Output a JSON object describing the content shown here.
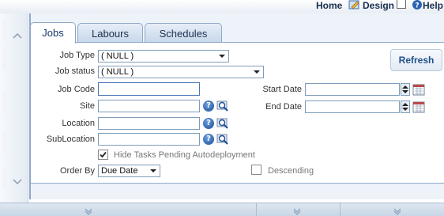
{
  "topnav": {
    "home": "Home",
    "design": "Design",
    "help": "Help"
  },
  "tabs": [
    {
      "label": "Jobs",
      "active": true
    },
    {
      "label": "Labours",
      "active": false
    },
    {
      "label": "Schedules",
      "active": false
    }
  ],
  "form": {
    "job_type": {
      "label": "Job Type",
      "value": "( NULL )"
    },
    "job_status": {
      "label": "Job status",
      "value": "( NULL )"
    },
    "job_code": {
      "label": "Job Code",
      "value": ""
    },
    "site": {
      "label": "Site",
      "value": ""
    },
    "location": {
      "label": "Location",
      "value": ""
    },
    "sublocation": {
      "label": "SubLocation",
      "value": ""
    },
    "start_date": {
      "label": "Start Date",
      "value": ""
    },
    "end_date": {
      "label": "End Date",
      "value": ""
    },
    "hide_tasks": {
      "label": "Hide Tasks Pending Autodeployment",
      "checked": true
    },
    "order_by": {
      "label": "Order By",
      "value": "Due Date"
    },
    "descending": {
      "label": "Descending",
      "checked": false
    }
  },
  "refresh_label": "Refresh",
  "icons": {
    "help": "help-icon",
    "lookup": "lookup-icon",
    "calendar": "calendar-icon",
    "spin": "spin-icon"
  },
  "colors": {
    "accent": "#1f4f8a",
    "border": "#8ea9c8",
    "help_blue": "#1d4e99"
  }
}
